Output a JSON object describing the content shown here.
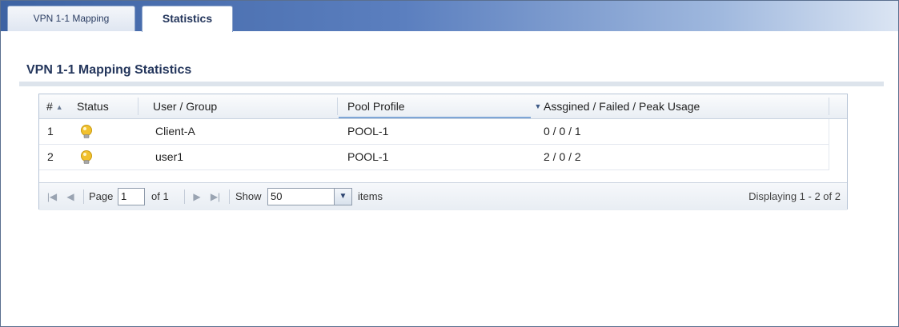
{
  "tabs": [
    {
      "label": "VPN 1-1 Mapping",
      "active": false
    },
    {
      "label": "Statistics",
      "active": true
    }
  ],
  "section": {
    "title": "VPN 1-1 Mapping Statistics"
  },
  "table": {
    "columns": [
      "#",
      "Status",
      "User / Group",
      "Pool Profile",
      "Assgined / Failed / Peak Usage"
    ],
    "sorted_column": "#",
    "rows": [
      {
        "index": "1",
        "status": "lightbulb-icon",
        "user_group": "Client-A",
        "pool_profile": "POOL-1",
        "usage": "0 / 0 / 1"
      },
      {
        "index": "2",
        "status": "lightbulb-icon",
        "user_group": "user1",
        "pool_profile": "POOL-1",
        "usage": "2 / 0 / 2"
      }
    ]
  },
  "pager": {
    "page_label": "Page",
    "page_value": "1",
    "of_label": "of 1",
    "show_label": "Show",
    "show_value": "50",
    "items_label": "items",
    "display_text": "Displaying 1 - 2 of 2"
  },
  "colors": {
    "tab_bar": "#3e63a3",
    "section_title": "#24365c",
    "bulb": "#f2c12e"
  }
}
